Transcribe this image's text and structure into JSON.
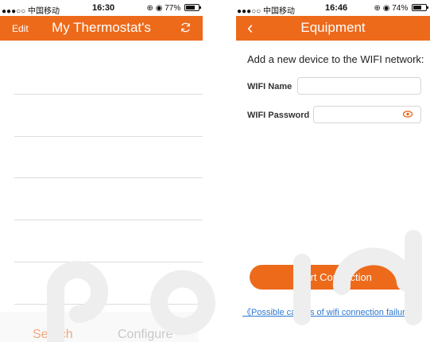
{
  "left_screen": {
    "status": {
      "carrier": "●●●○○ 中国移动",
      "time": "16:30",
      "battery": "77%",
      "battery_level": 0.77
    },
    "nav": {
      "edit": "Edit",
      "title": "My Thermostat's",
      "refresh_icon": "refresh-icon"
    },
    "tabs": {
      "search": "Search",
      "configure": "Configure"
    },
    "colors": {
      "accent": "#ed6a1b",
      "inactive_tab": "#a6a6a6"
    }
  },
  "right_screen": {
    "status": {
      "carrier": "●●●○○ 中国移动",
      "time": "16:46",
      "battery": "74%",
      "battery_level": 0.74
    },
    "nav": {
      "back_icon": "chevron-left-icon",
      "title": "Equipment"
    },
    "prompt": "Add a new device to the WIFI network:",
    "wifi_name": {
      "label": "WIFI Name",
      "value": ""
    },
    "wifi_password": {
      "label": "WIFI Password",
      "value": "",
      "toggle_icon": "eye-icon"
    },
    "start_button": "Start Connection",
    "causes_link": "《Possible causes of wifi connection failure》",
    "colors": {
      "accent": "#ed6a1b",
      "link": "#2f78d1"
    }
  }
}
